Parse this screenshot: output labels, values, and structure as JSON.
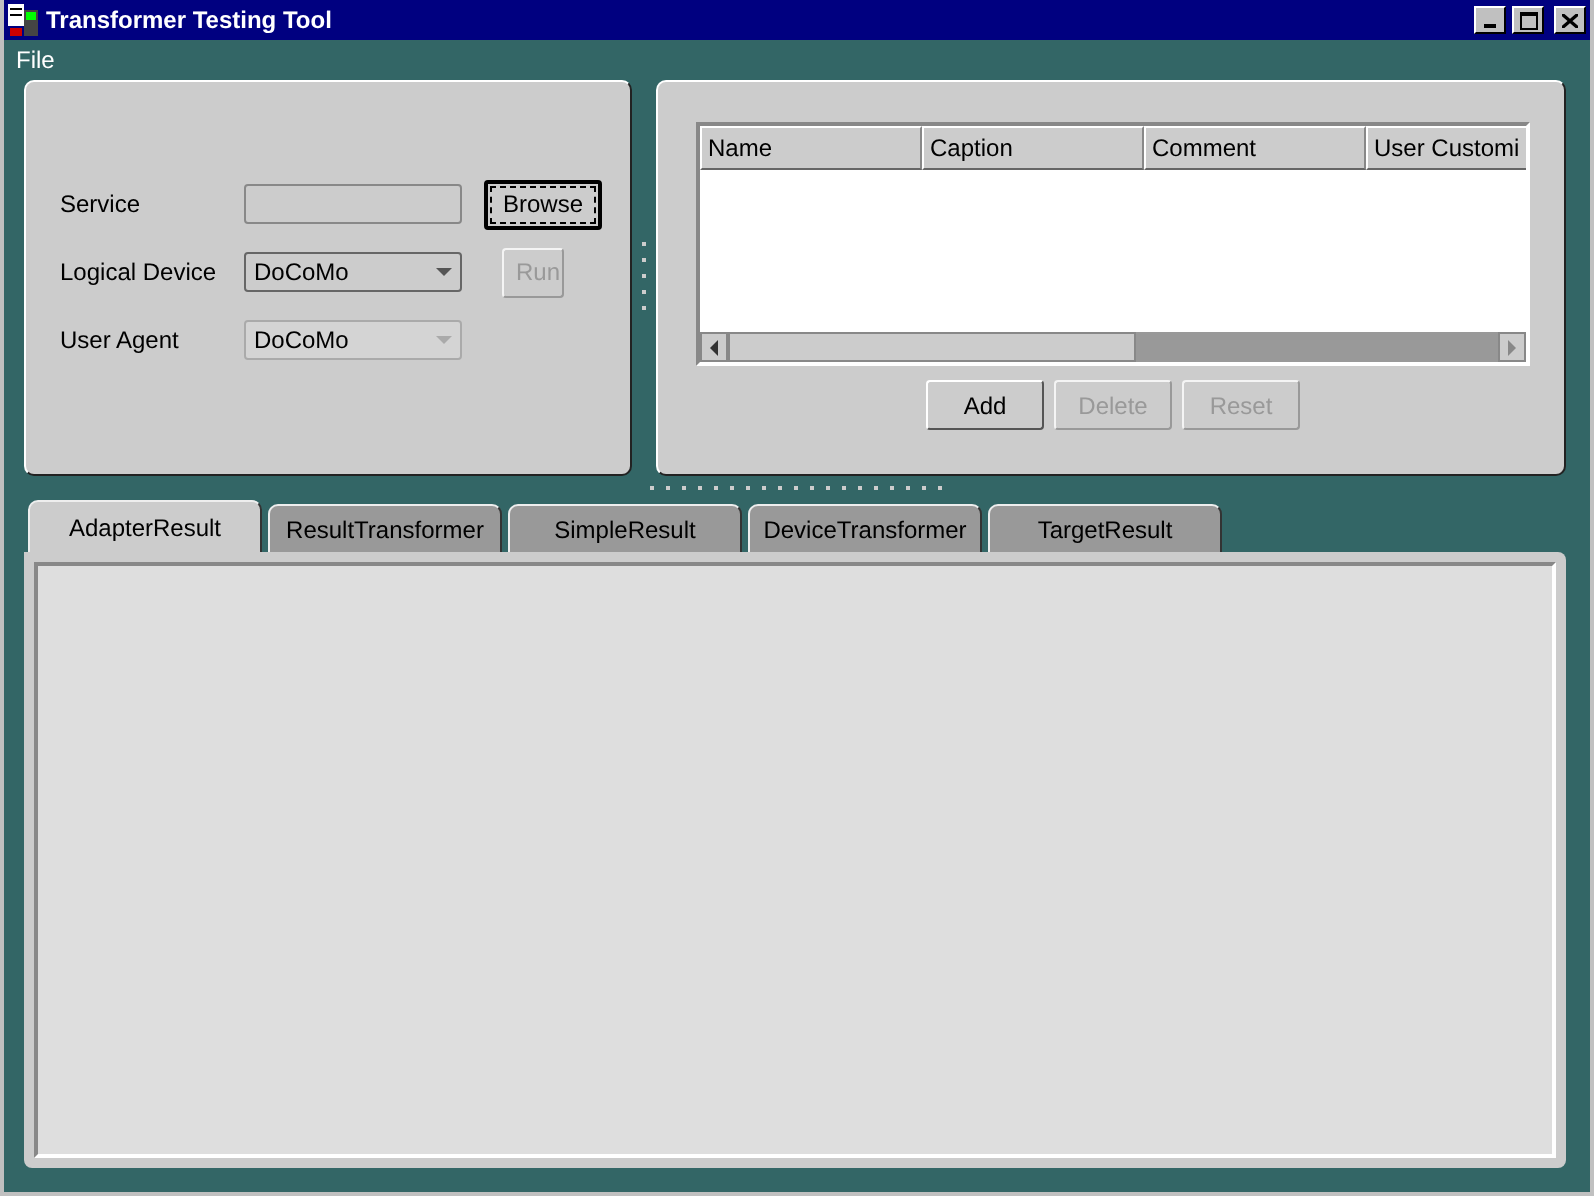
{
  "window": {
    "title": "Transformer Testing Tool"
  },
  "menu": [
    {
      "label": "File"
    }
  ],
  "form": {
    "fields": [
      {
        "kind": "text",
        "label": "Service",
        "disabled": true
      },
      {
        "kind": "dropdown",
        "label": "Logical Device",
        "value": "DoCoMo",
        "disabled": false
      },
      {
        "kind": "dropdown",
        "label": "User Agent",
        "value": "DoCoMo",
        "disabled": true
      }
    ],
    "browse_button": {
      "label": "Browse",
      "focused": true,
      "disabled": false
    },
    "run_button": {
      "label": "Run",
      "disabled": true
    }
  },
  "table": {
    "columns": [
      "Name",
      "Caption",
      "Comment",
      "User Customi"
    ]
  },
  "table_buttons": [
    {
      "label": "Add",
      "disabled": false
    },
    {
      "label": "Delete",
      "disabled": true
    },
    {
      "label": "Reset",
      "disabled": true
    }
  ],
  "tabs": [
    {
      "label": "AdapterResult",
      "selected": true
    },
    {
      "label": "ResultTransformer",
      "selected": false
    },
    {
      "label": "SimpleResult",
      "selected": false
    },
    {
      "label": "DeviceTransformer",
      "selected": false
    },
    {
      "label": "TargetResult",
      "selected": false
    }
  ]
}
